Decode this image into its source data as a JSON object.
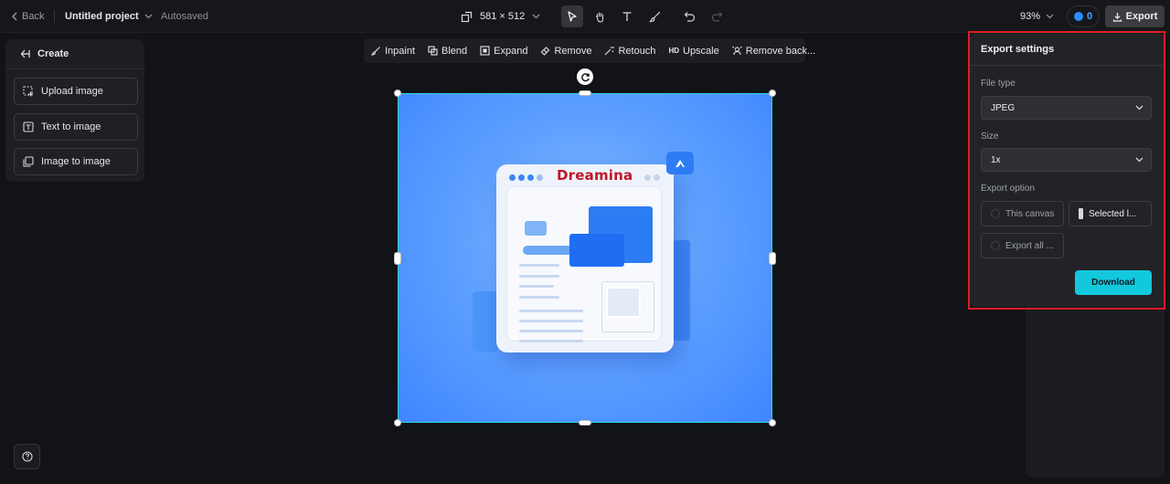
{
  "topbar": {
    "back_label": "Back",
    "project_name": "Untitled project",
    "autosaved": "Autosaved",
    "canvas_size": "581 × 512",
    "zoom": "93%",
    "credits": "0",
    "export_label": "Export"
  },
  "left_panel": {
    "title": "Create",
    "items": [
      {
        "label": "Upload image",
        "icon": "upload-image-icon"
      },
      {
        "label": "Text to image",
        "icon": "text-image-icon"
      },
      {
        "label": "Image to image",
        "icon": "image-image-icon"
      }
    ]
  },
  "edit_toolbar": {
    "items": [
      {
        "label": "Inpaint",
        "icon": "inpaint-icon"
      },
      {
        "label": "Blend",
        "icon": "blend-icon"
      },
      {
        "label": "Expand",
        "icon": "expand-icon"
      },
      {
        "label": "Remove",
        "icon": "eraser-icon"
      },
      {
        "label": "Retouch",
        "icon": "retouch-icon"
      },
      {
        "label": "Upscale",
        "icon": "hd-icon",
        "badge": "HD"
      },
      {
        "label": "Remove back...",
        "icon": "remove-background-icon"
      }
    ]
  },
  "canvas": {
    "brand_text": "Dreamina"
  },
  "export_panel": {
    "title": "Export settings",
    "file_type_label": "File type",
    "file_type_value": "JPEG",
    "size_label": "Size",
    "size_value": "1x",
    "export_option_label": "Export option",
    "options": [
      {
        "label": "This canvas",
        "selected": false
      },
      {
        "label": "Selected l...",
        "selected": true
      },
      {
        "label": "Export all ...",
        "selected": false
      }
    ],
    "download_label": "Download"
  },
  "colors": {
    "accent": "#12c8dd",
    "selection": "#28d7e8",
    "highlight": "#e01b24"
  }
}
